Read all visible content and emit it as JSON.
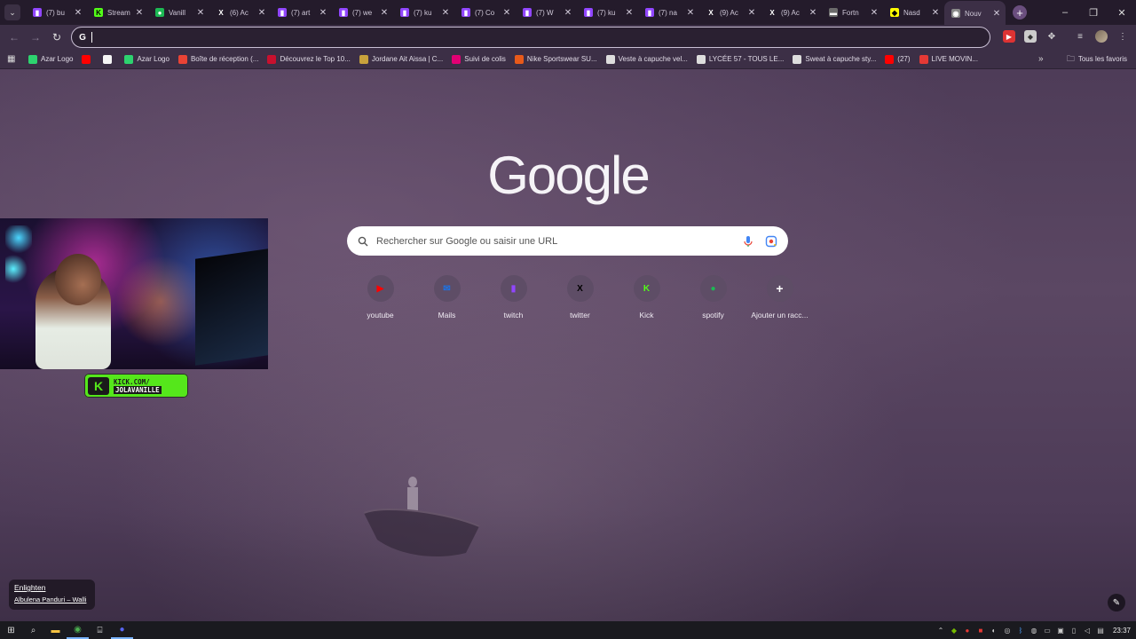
{
  "tabs": [
    {
      "title": "(7) bu",
      "icon": "twitch-icon",
      "color": "#9146ff"
    },
    {
      "title": "Stream",
      "icon": "kick-icon",
      "color": "#53fc18"
    },
    {
      "title": "Vanill",
      "icon": "spotify-icon",
      "color": "#1db954"
    },
    {
      "title": "(6) Ac",
      "icon": "x-icon",
      "color": "#000000"
    },
    {
      "title": "(7) art",
      "icon": "twitch-icon",
      "color": "#9146ff"
    },
    {
      "title": "(7) we",
      "icon": "twitch-icon",
      "color": "#9146ff"
    },
    {
      "title": "(7) ku",
      "icon": "twitch-icon",
      "color": "#9146ff"
    },
    {
      "title": "(7) Co",
      "icon": "twitch-icon",
      "color": "#9146ff"
    },
    {
      "title": "(7) W",
      "icon": "twitch-icon",
      "color": "#9146ff"
    },
    {
      "title": "(7) ku",
      "icon": "twitch-icon",
      "color": "#9146ff"
    },
    {
      "title": "(7) na",
      "icon": "twitch-icon",
      "color": "#9146ff"
    },
    {
      "title": "(9) Ac",
      "icon": "x-icon",
      "color": "#000000"
    },
    {
      "title": "(9) Ac",
      "icon": "x-icon",
      "color": "#000000"
    },
    {
      "title": "Fortn",
      "icon": "fortnite-icon",
      "color": "#6b6b6b"
    },
    {
      "title": "Nasd",
      "icon": "snapchat-icon",
      "color": "#fffc00"
    },
    {
      "title": "Nouv",
      "icon": "chrome-icon",
      "color": "#888888",
      "active": true
    }
  ],
  "toolbar": {
    "omnibox_value": ""
  },
  "bookmarks": [
    {
      "label": "Azar Logo",
      "color": "#2dd36f"
    },
    {
      "label": "",
      "color": "#ff0000"
    },
    {
      "label": "",
      "color": "#f5f5f5"
    },
    {
      "label": "Azar Logo",
      "color": "#2dd36f"
    },
    {
      "label": "Boîte de réception (...",
      "color": "#ea4335"
    },
    {
      "label": "Découvrez le Top 10...",
      "color": "#c8102e"
    },
    {
      "label": "Jordane Ait Aissa | C...",
      "color": "#c8a23c"
    },
    {
      "label": "Suivi de colis",
      "color": "#e20074"
    },
    {
      "label": "Nike Sportswear SU...",
      "color": "#e85a1a"
    },
    {
      "label": "Veste à capuche vel...",
      "color": "#dddddd"
    },
    {
      "label": "LYCÉE 57 - TOUS LE...",
      "color": "#dddddd"
    },
    {
      "label": "Sweat à capuche sty...",
      "color": "#dddddd"
    },
    {
      "label": "(27)",
      "color": "#ff0000"
    },
    {
      "label": "LIVE MOVIN...",
      "color": "#e53935"
    }
  ],
  "bookmarks_all": "Tous les favoris",
  "ntp": {
    "logo": "Google",
    "search_placeholder": "Rechercher sur Google ou saisir une URL",
    "shortcuts": [
      {
        "label": "youtube",
        "icon": "youtube-icon",
        "color": "#ff0000"
      },
      {
        "label": "Mails",
        "icon": "mail-icon",
        "color": "#1a73e8"
      },
      {
        "label": "twitch",
        "icon": "twitch-icon",
        "color": "#9146ff"
      },
      {
        "label": "twitter",
        "icon": "x-icon",
        "color": "#000000"
      },
      {
        "label": "Kick",
        "icon": "kick-icon",
        "color": "#53fc18"
      },
      {
        "label": "spotify",
        "icon": "spotify-icon",
        "color": "#1db954"
      },
      {
        "label": "Ajouter un racc...",
        "icon": "plus-icon",
        "color": "#ffffff"
      }
    ],
    "credit_title": "Enlighten",
    "credit_author": "Albulena Panduri – Walli"
  },
  "kick_badge": {
    "line1": "KICK.COM/",
    "line2": "JOLAVANILLE"
  },
  "taskbar": {
    "clock": "23:37"
  }
}
